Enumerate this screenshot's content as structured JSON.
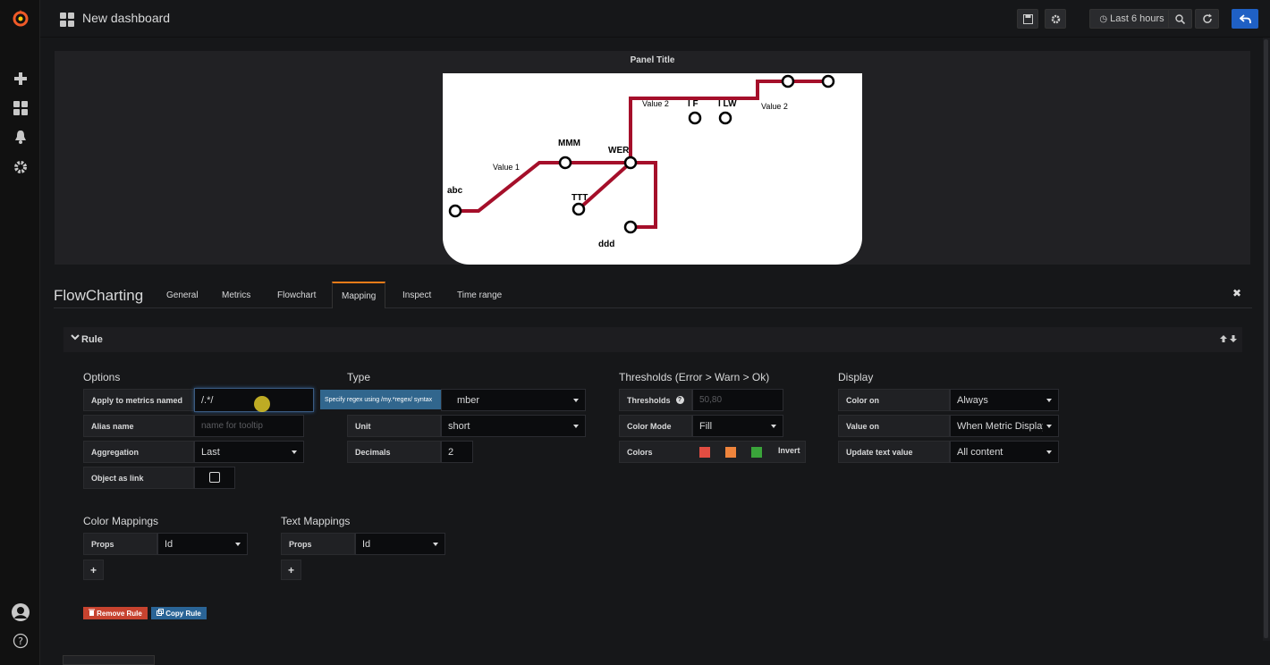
{
  "sidemenu": {
    "items": [
      "grafana-logo-icon",
      "plus-icon",
      "dashboards-icon",
      "bell-icon",
      "gear-icon"
    ],
    "bottom": [
      "avatar",
      "help-icon"
    ],
    "help_label": "?"
  },
  "topbar": {
    "title": "New dashboard",
    "time_range": "Last 6 hours",
    "accent": "#1f60c4"
  },
  "panel": {
    "title": "Panel Title",
    "flowchart_labels": {
      "abc": "abc",
      "mmm": "MMM",
      "wer": "WER",
      "ttt": "TTT",
      "ddd": "ddd",
      "if": "I F",
      "ilw": "I LW",
      "value1": "Value 1",
      "value2a": "Value 2",
      "value2b": "Value 2"
    },
    "line_color": "#a50f2a"
  },
  "editor": {
    "title": "FlowCharting",
    "tabs": [
      "General",
      "Metrics",
      "Flowchart",
      "Mapping",
      "Inspect",
      "Time range"
    ],
    "active_tab": "Mapping",
    "close": "✖"
  },
  "rule": {
    "header": "Rule",
    "chevron": "⌄",
    "move_arrows": "🡡🡣"
  },
  "options": {
    "heading": "Options",
    "apply_label": "Apply to metrics named",
    "apply_value": "/.*/",
    "tooltip": "Specify regex using /my.*regex/ syntax",
    "alias_label": "Alias name",
    "alias_placeholder": "name for tooltip",
    "aggregation_label": "Aggregation",
    "aggregation_value": "Last",
    "object_link_label": "Object as link"
  },
  "type": {
    "heading": "Type",
    "type_value": "mber",
    "unit_label": "Unit",
    "unit_value": "short",
    "decimals_label": "Decimals",
    "decimals_value": "2"
  },
  "thresholds": {
    "heading": "Thresholds (Error > Warn > Ok)",
    "thresholds_label": "Thresholds",
    "thresholds_placeholder": "50,80",
    "color_mode_label": "Color Mode",
    "color_mode_value": "Fill",
    "colors_label": "Colors",
    "colors": [
      "#e24d42",
      "#ef843c",
      "#3aa43a"
    ],
    "invert_label": "Invert"
  },
  "display": {
    "heading": "Display",
    "color_on_label": "Color on",
    "color_on_value": "Always",
    "value_on_label": "Value on",
    "value_on_value": "When Metric Display",
    "update_text_label": "Update text value",
    "update_text_value": "All content"
  },
  "color_mappings": {
    "heading": "Color Mappings",
    "props_label": "Props",
    "props_value": "Id",
    "add": "+"
  },
  "text_mappings": {
    "heading": "Text Mappings",
    "props_label": "Props",
    "props_value": "Id",
    "add": "+"
  },
  "actions": {
    "remove_rule": "Remove Rule",
    "copy_rule": "Copy Rule"
  }
}
